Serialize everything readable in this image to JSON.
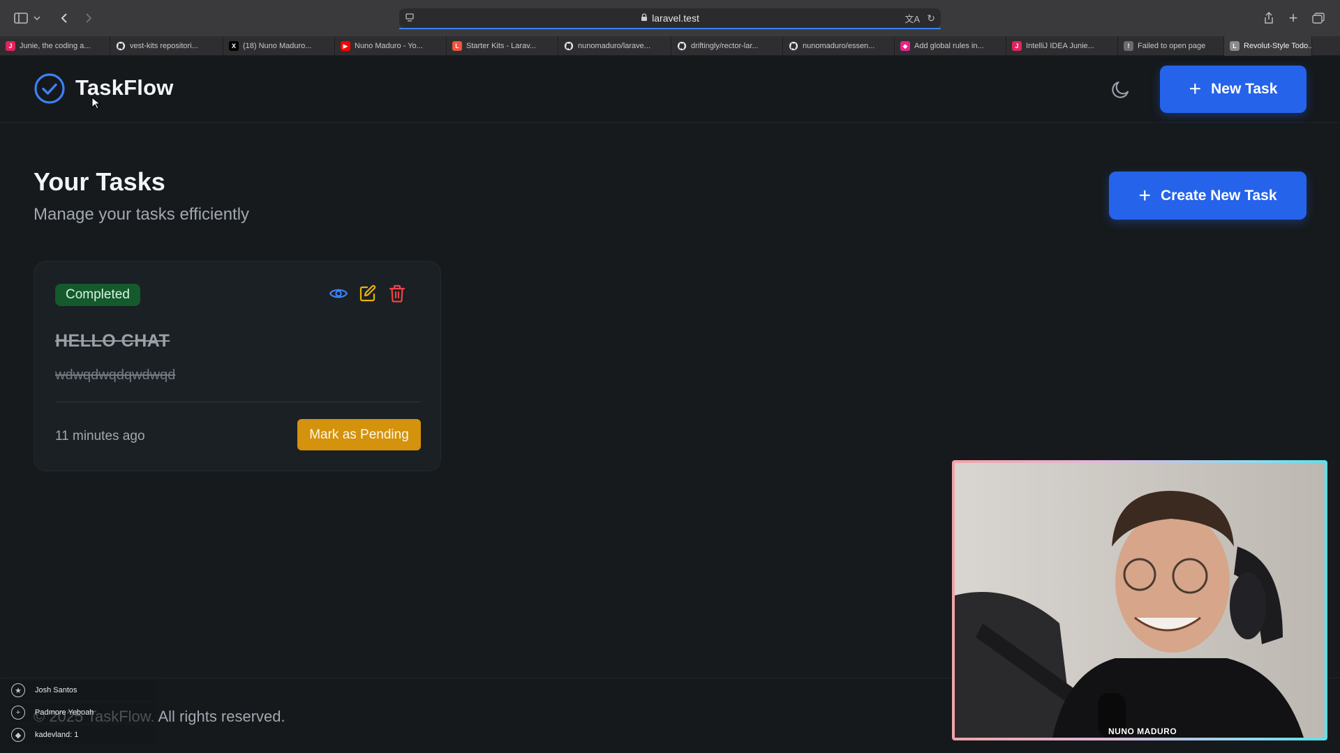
{
  "browser": {
    "url": "laravel.test",
    "tabs": [
      {
        "label": "Junie, the coding a...",
        "favicon_color": "#e0245e",
        "favicon_glyph": "J"
      },
      {
        "label": "vest-kits repositori...",
        "favicon_color": "#3a3a3c",
        "favicon_glyph": "github"
      },
      {
        "label": "(18) Nuno Maduro...",
        "favicon_color": "#000000",
        "favicon_glyph": "X"
      },
      {
        "label": "Nuno Maduro - Yo...",
        "favicon_color": "#ff0000",
        "favicon_glyph": "▶"
      },
      {
        "label": "Starter Kits - Larav...",
        "favicon_color": "#f05340",
        "favicon_glyph": "L"
      },
      {
        "label": "nunomaduro/larave...",
        "favicon_color": "#3a3a3c",
        "favicon_glyph": "github"
      },
      {
        "label": "driftingly/rector-lar...",
        "favicon_color": "#3a3a3c",
        "favicon_glyph": "github"
      },
      {
        "label": "nunomaduro/essen...",
        "favicon_color": "#3a3a3c",
        "favicon_glyph": "github"
      },
      {
        "label": "Add global rules in...",
        "favicon_color": "#e6248a",
        "favicon_glyph": "◆"
      },
      {
        "label": "IntelliJ IDEA Junie...",
        "favicon_color": "#e0245e",
        "favicon_glyph": "J"
      },
      {
        "label": "Failed to open page",
        "favicon_color": "#6b6b70",
        "favicon_glyph": "!"
      },
      {
        "label": "Revolut-Style Todo...",
        "favicon_color": "#8a8a90",
        "favicon_glyph": "L",
        "active": true
      }
    ]
  },
  "app": {
    "name": "TaskFlow",
    "new_task_label": "New Task",
    "theme_icon": "moon-icon",
    "accent_color": "#2563eb"
  },
  "page": {
    "title": "Your Tasks",
    "subtitle": "Manage your tasks efficiently",
    "create_label": "Create New Task"
  },
  "task": {
    "status": "Completed",
    "title": "HELLO CHAT",
    "description": "wdwqdwqdqwdwqd",
    "time": "11 minutes ago",
    "action_label": "Mark as Pending",
    "icons": [
      "eye-icon",
      "edit-icon",
      "trash-icon"
    ],
    "status_color": "#145a2d",
    "action_color": "#d4920d"
  },
  "footer": {
    "text": "© 2025 TaskFlow. All rights reserved."
  },
  "stream": {
    "viewers": [
      {
        "name": "Josh Santos"
      },
      {
        "name": "Padmore Yeboah"
      },
      {
        "name": "kadevland: 1"
      }
    ],
    "webcam_name": "NUNO MADURO"
  }
}
